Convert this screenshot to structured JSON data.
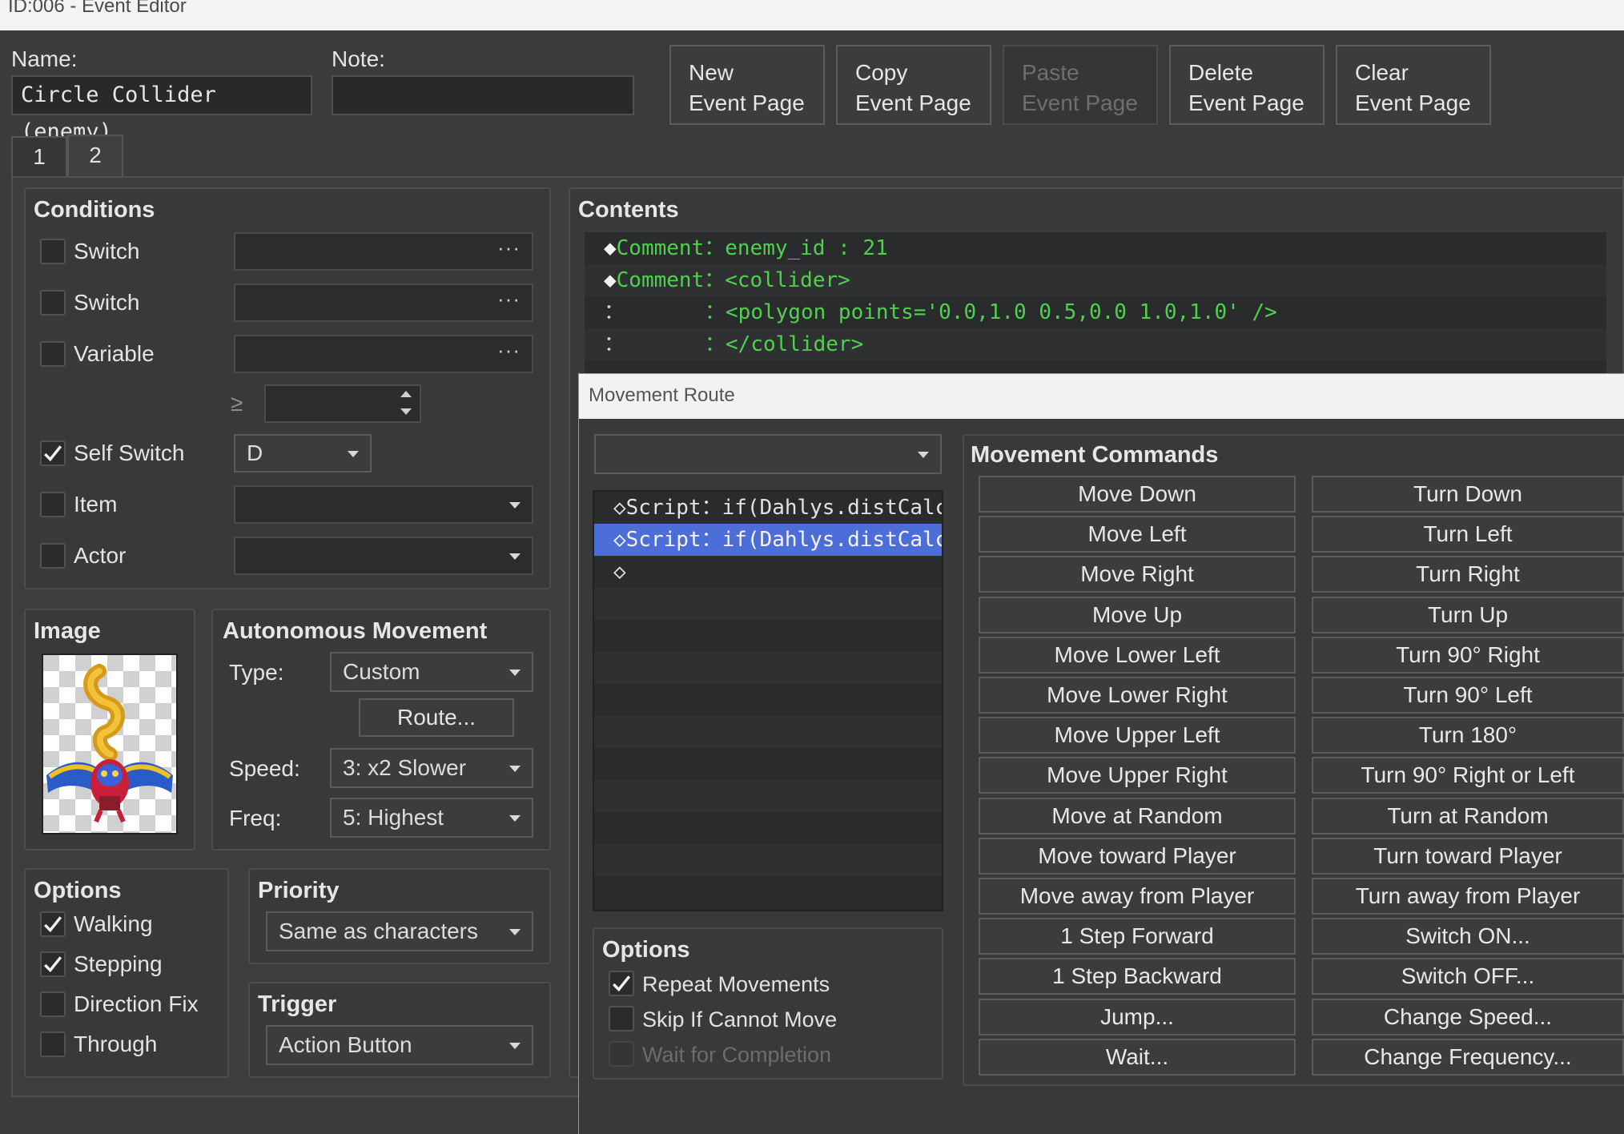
{
  "window": {
    "title": "ID:006 - Event Editor"
  },
  "name": {
    "label": "Name:",
    "value": "Circle Collider (enemy)"
  },
  "note": {
    "label": "Note:",
    "value": ""
  },
  "toolbar": {
    "new_l1": "New",
    "new_l2": "Event Page",
    "copy_l1": "Copy",
    "copy_l2": "Event Page",
    "paste_l1": "Paste",
    "paste_l2": "Event Page",
    "delete_l1": "Delete",
    "delete_l2": "Event Page",
    "clear_l1": "Clear",
    "clear_l2": "Event Page"
  },
  "tabs": [
    "1",
    "2"
  ],
  "conditions": {
    "title": "Conditions",
    "switch1": "Switch",
    "switch2": "Switch",
    "variable": "Variable",
    "ellipsis": "···",
    "gte": "≥",
    "self_switch": "Self Switch",
    "self_switch_value": "D",
    "item": "Item",
    "actor": "Actor"
  },
  "image": {
    "title": "Image"
  },
  "autonomous": {
    "title": "Autonomous Movement",
    "type_label": "Type:",
    "type_value": "Custom",
    "route_button": "Route...",
    "speed_label": "Speed:",
    "speed_value": "3: x2 Slower",
    "freq_label": "Freq:",
    "freq_value": "5: Highest"
  },
  "options": {
    "title": "Options",
    "walking": "Walking",
    "stepping": "Stepping",
    "direction_fix": "Direction Fix",
    "through": "Through"
  },
  "priority": {
    "title": "Priority",
    "value": "Same as characters"
  },
  "trigger": {
    "title": "Trigger",
    "value": "Action Button"
  },
  "contents": {
    "title": "Contents",
    "rows": [
      {
        "bullet": "◆",
        "cmd": "Comment",
        "sep": "：",
        "text": "enemy_id : 21"
      },
      {
        "bullet": "◆",
        "cmd": "Comment",
        "sep": "：",
        "text": "<collider>"
      },
      {
        "bullet": "：",
        "cmd": "",
        "sep": "：",
        "text": "<polygon points='0.0,1.0 0.5,0.0 1.0,1.0' />"
      },
      {
        "bullet": "：",
        "cmd": "",
        "sep": "：",
        "text": "</collider>"
      }
    ]
  },
  "movement_route": {
    "title": "Movement Route",
    "target_value": "",
    "list": [
      {
        "bullet": "◇",
        "text": "Script：if(Dahlys.distCalc···"
      },
      {
        "bullet": "◇",
        "text": "Script：if(Dahlys.distCalc···"
      },
      {
        "bullet": "◇",
        "text": ""
      }
    ],
    "options_title": "Options",
    "repeat": "Repeat Movements",
    "skip": "Skip If Cannot Move",
    "wait": "Wait for Completion",
    "commands_title": "Movement Commands",
    "col1": [
      "Move Down",
      "Move Left",
      "Move Right",
      "Move Up",
      "Move Lower Left",
      "Move Lower Right",
      "Move Upper Left",
      "Move Upper Right",
      "Move at Random",
      "Move toward Player",
      "Move away from Player",
      "1 Step Forward",
      "1 Step Backward",
      "Jump...",
      "Wait..."
    ],
    "col2": [
      "Turn Down",
      "Turn Left",
      "Turn Right",
      "Turn Up",
      "Turn 90° Right",
      "Turn 90° Left",
      "Turn 180°",
      "Turn 90° Right or Left",
      "Turn at Random",
      "Turn toward Player",
      "Turn away from Player",
      "Switch ON...",
      "Switch OFF...",
      "Change Speed...",
      "Change Frequency..."
    ]
  },
  "colors": {
    "selection": "#4d6ed9",
    "comment_green": "#4fd14f"
  }
}
